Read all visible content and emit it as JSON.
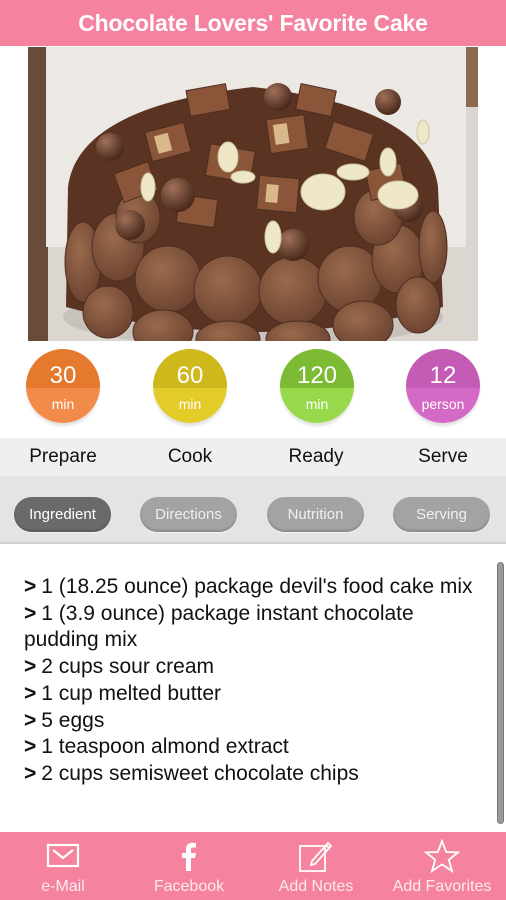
{
  "header": {
    "title": "Chocolate Lovers' Favorite Cake"
  },
  "photo": {
    "alt": "Chocolate cake covered with chocolate buttons, candy bar pieces and malt balls"
  },
  "stats": [
    {
      "value": "30",
      "unit": "min",
      "label": "Prepare",
      "color_top": "#e57a2f",
      "color_bottom": "#f28b4a"
    },
    {
      "value": "60",
      "unit": "min",
      "label": "Cook",
      "color_top": "#cfb81c",
      "color_bottom": "#e3cb2a"
    },
    {
      "value": "120",
      "unit": "min",
      "label": "Ready",
      "color_top": "#7dbb34",
      "color_bottom": "#98d94c"
    },
    {
      "value": "12",
      "unit": "person",
      "label": "Serve",
      "color_top": "#c45bb4",
      "color_bottom": "#d46ac6"
    }
  ],
  "tabs": [
    {
      "label": "Ingredient",
      "active": true
    },
    {
      "label": "Directions",
      "active": false
    },
    {
      "label": "Nutrition",
      "active": false
    },
    {
      "label": "Serving",
      "active": false
    }
  ],
  "ingredients": {
    "bullet": ">",
    "items": [
      "1 (18.25 ounce) package devil's food cake mix",
      "1 (3.9 ounce) package instant chocolate pudding mix",
      "2 cups sour cream",
      "1 cup melted butter",
      "5 eggs",
      "1 teaspoon almond extract",
      "2 cups semisweet chocolate chips"
    ]
  },
  "footer": [
    {
      "label": "e-Mail",
      "icon": "envelope-icon"
    },
    {
      "label": "Facebook",
      "icon": "facebook-icon"
    },
    {
      "label": "Add Notes",
      "icon": "edit-note-icon"
    },
    {
      "label": "Add Favorites",
      "icon": "star-icon"
    }
  ],
  "colors": {
    "brand_pink": "#f5839f",
    "tab_active": "#6a6a6a",
    "tab_inactive": "#a3a3a3"
  }
}
